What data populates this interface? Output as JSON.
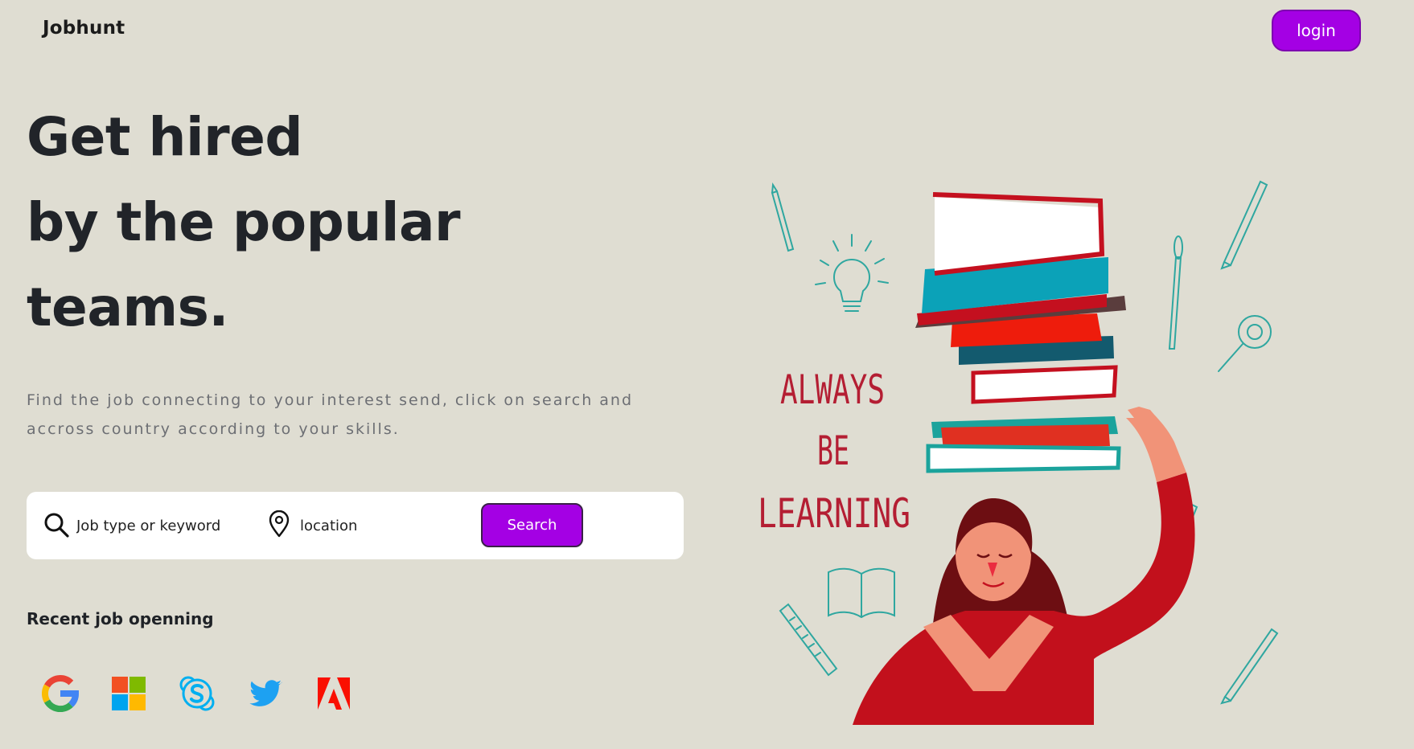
{
  "nav": {
    "brand": "Jobhunt",
    "login_label": "login"
  },
  "hero": {
    "title_lines": [
      "Get hired",
      "by the popular",
      "teams."
    ],
    "subtitle": "Find the job connecting to your interest send, click on search and accross country according to your skills."
  },
  "search": {
    "keyword_placeholder": "Job type or keyword",
    "location_placeholder": "location",
    "button_label": "Search",
    "icons": [
      "search-icon",
      "location-pin-icon"
    ]
  },
  "recent": {
    "title": "Recent job openning",
    "companies": [
      "google-logo",
      "microsoft-logo",
      "skype-logo",
      "twitter-logo",
      "adobe-logo"
    ]
  },
  "illustration": {
    "lettering": [
      "ALWAYS",
      "BE",
      "LEARNING"
    ]
  },
  "colors": {
    "background": "#dfddd2",
    "accent": "#a400e4",
    "text": "#212429",
    "muted": "#6d6f74"
  }
}
